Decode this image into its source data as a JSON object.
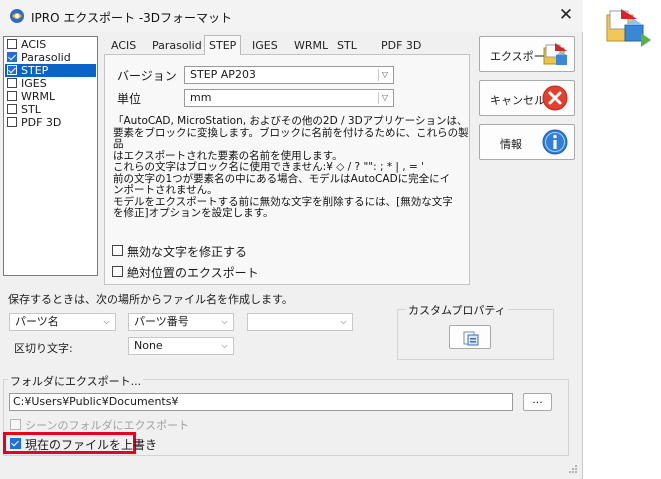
{
  "window": {
    "title": "IPRO エクスポート -3Dフォーマット",
    "close_glyph": "✕"
  },
  "formats": [
    {
      "label": "ACIS",
      "checked": false,
      "selected": false
    },
    {
      "label": "Parasolid",
      "checked": true,
      "selected": false
    },
    {
      "label": "STEP",
      "checked": true,
      "selected": true
    },
    {
      "label": "IGES",
      "checked": false,
      "selected": false
    },
    {
      "label": "WRML",
      "checked": false,
      "selected": false
    },
    {
      "label": "STL",
      "checked": false,
      "selected": false
    },
    {
      "label": "PDF 3D",
      "checked": false,
      "selected": false
    }
  ],
  "tabs": [
    "ACIS",
    "Parasolid",
    "STEP",
    "IGES",
    "WRML",
    "STL",
    "PDF 3D"
  ],
  "active_tab": "STEP",
  "step": {
    "version_label": "バージョン",
    "version_value": "STEP AP203",
    "unit_label": "単位",
    "unit_value": "mm",
    "description": "「AutoCAD, MicroStation, およびその他の2D / 3Dアプリケーションは、\n要素をブロックに変換します。ブロックに名前を付けるために、これらの製品\nはエクスポートされた要素の名前を使用します。\nこれらの文字はブロック名に使用できません:¥ ◇ / ? \"\": ; * | , = '\n前の文字の1つが要素名の中にある場合、モデルはAutoCADに完全にイ\nンポートされません。\nモデルをエクスポートする前に無効な文字を削除するには、[無効な文字\nを修正]オプションを設定します。",
    "fix_invalid_label": "無効な文字を修正する",
    "absolute_position_label": "絶対位置のエクスポート"
  },
  "buttons": {
    "export_label": "エクスポート",
    "cancel_label": "キャンセル",
    "info_label": "情報"
  },
  "save": {
    "heading": "保存するときは、次の場所からファイル名を作成します。",
    "combo1": "パーツ名",
    "combo2": "パーツ番号",
    "combo3": "",
    "separator_label": "区切り文字:",
    "separator_value": "None",
    "custom_props_label": "カスタムプロパティ"
  },
  "folder": {
    "heading": "フォルダにエクスポート...",
    "path": "C:¥Users¥Public¥Documents¥",
    "browse_label": "...",
    "scene_folder_label": "シーンのフォルダにエクスポート",
    "overwrite_label": "現在のファイルを上書き",
    "overwrite_checked": true
  },
  "colors": {
    "accent": "#1e6fd9",
    "selection": "#0a63c7",
    "highlight_border": "#e8001c",
    "dialog_bg": "#f0f0f0"
  }
}
